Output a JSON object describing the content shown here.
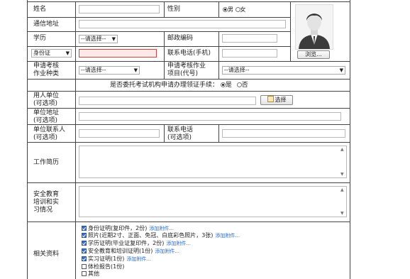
{
  "form": {
    "name_label": "姓名",
    "gender_label": "性别",
    "gender_options": [
      "男",
      "女"
    ],
    "address_label": "通信地址",
    "education_label": "学历",
    "education_select": "--请选择--",
    "postcode_label": "邮政编码",
    "id_type_select": "身份证",
    "phone_label": "联系电话(手机)",
    "browse_button": "浏览...",
    "job_type_label_1": "申请考核",
    "job_type_label_2": "作业种类",
    "job_type_select": "--请选择--",
    "job_item_label_1": "申请考核作业",
    "job_item_label_2": "项目(代号)",
    "job_item_select": "--请选择--",
    "entrust_question": "是否委托考试机构申请办理领证手续：",
    "entrust_options": [
      "是",
      "否"
    ],
    "employer_label_1": "用人单位",
    "employer_label_2": "(可选项)",
    "select_button": "选择",
    "unit_address_label_1": "单位地址",
    "unit_address_label_2": "(可选项)",
    "unit_contact_label_1": "单位联系人",
    "unit_contact_label_2": "(可选项)",
    "unit_phone_label_1": "联系电话",
    "unit_phone_label_2": "(可选项)",
    "work_history_label": "工作简历",
    "safety_training_label_1": "安全教育",
    "safety_training_label_2": "培训和实",
    "safety_training_label_3": "习情况",
    "materials_label": "相关资料"
  },
  "documents": [
    {
      "label": "身份证明(复印件，2份)",
      "checked": true,
      "link": "添加附件..."
    },
    {
      "label": "照片(近期2寸、正面、免冠、白底彩色照片，3张)",
      "checked": true,
      "link": "添加附件..."
    },
    {
      "label": "学历证明(毕业证复印件，2份)",
      "checked": true,
      "link": "添加附件..."
    },
    {
      "label": "安全教育和培训证明(1份)",
      "checked": true,
      "link": "添加附件..."
    },
    {
      "label": "实习证明(1份)",
      "checked": true,
      "link": "添加附件..."
    },
    {
      "label": "体检报告(1份)",
      "checked": false,
      "link": ""
    },
    {
      "label": "其他",
      "checked": false,
      "link": ""
    }
  ],
  "colors": {
    "border": "#444444",
    "link": "#2a6ad8",
    "error_fill": "#fde8e8"
  }
}
